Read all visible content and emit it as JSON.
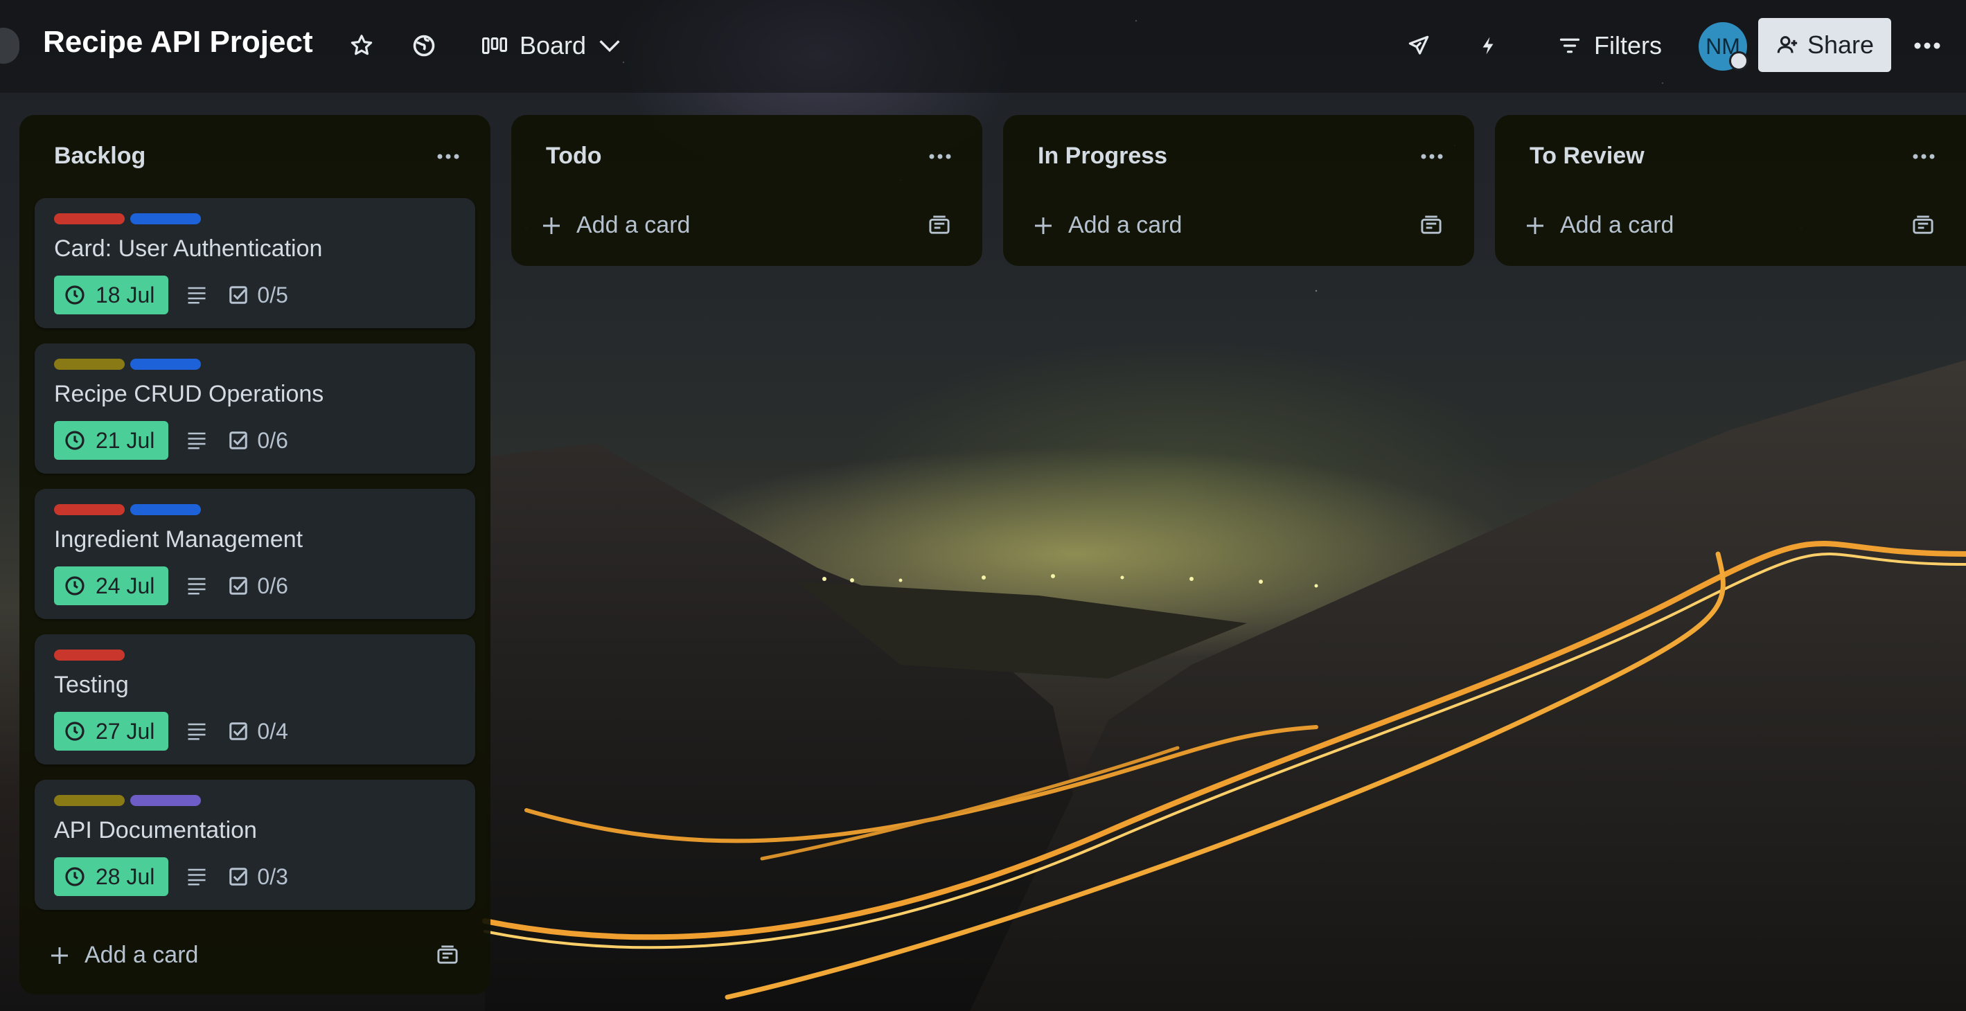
{
  "board": {
    "title": "Recipe API Project",
    "view_label": "Board"
  },
  "header": {
    "filters_label": "Filters",
    "avatar_initials": "NM",
    "share_label": "Share"
  },
  "colors": {
    "label_red": "#c9372c",
    "label_blue": "#1d62d8",
    "label_olive": "#8a7a16",
    "label_purple": "#6e5dc6",
    "due_green": "#4bce97"
  },
  "lists": [
    {
      "title": "Backlog",
      "add_card_label": "Add a card",
      "cards": [
        {
          "title": "Card: User Authentication",
          "labels": [
            "red",
            "blue"
          ],
          "due": "18 Jul",
          "checklist": "0/5"
        },
        {
          "title": "Recipe CRUD Operations",
          "labels": [
            "olive",
            "blue"
          ],
          "due": "21 Jul",
          "checklist": "0/6"
        },
        {
          "title": "Ingredient Management",
          "labels": [
            "red",
            "blue"
          ],
          "due": "24 Jul",
          "checklist": "0/6"
        },
        {
          "title": "Testing",
          "labels": [
            "red"
          ],
          "due": "27 Jul",
          "checklist": "0/4"
        },
        {
          "title": "API Documentation",
          "labels": [
            "olive",
            "purple"
          ],
          "due": "28 Jul",
          "checklist": "0/3"
        }
      ]
    },
    {
      "title": "Todo",
      "add_card_label": "Add a card",
      "cards": []
    },
    {
      "title": "In Progress",
      "add_card_label": "Add a card",
      "cards": []
    },
    {
      "title": "To Review",
      "add_card_label": "Add a card",
      "cards": []
    }
  ],
  "icons": {
    "star": "star-icon",
    "visibility": "globe-icon",
    "board_view": "board-view-icon",
    "chevron": "chevron-down-icon",
    "rocket": "rocket-icon",
    "automation": "lightning-icon",
    "filter": "filter-icon",
    "share": "add-person-icon",
    "more": "more-horizontal-icon",
    "clock": "clock-icon",
    "description": "description-icon",
    "checklist": "checkbox-icon",
    "plus": "plus-icon",
    "template": "card-template-icon"
  }
}
